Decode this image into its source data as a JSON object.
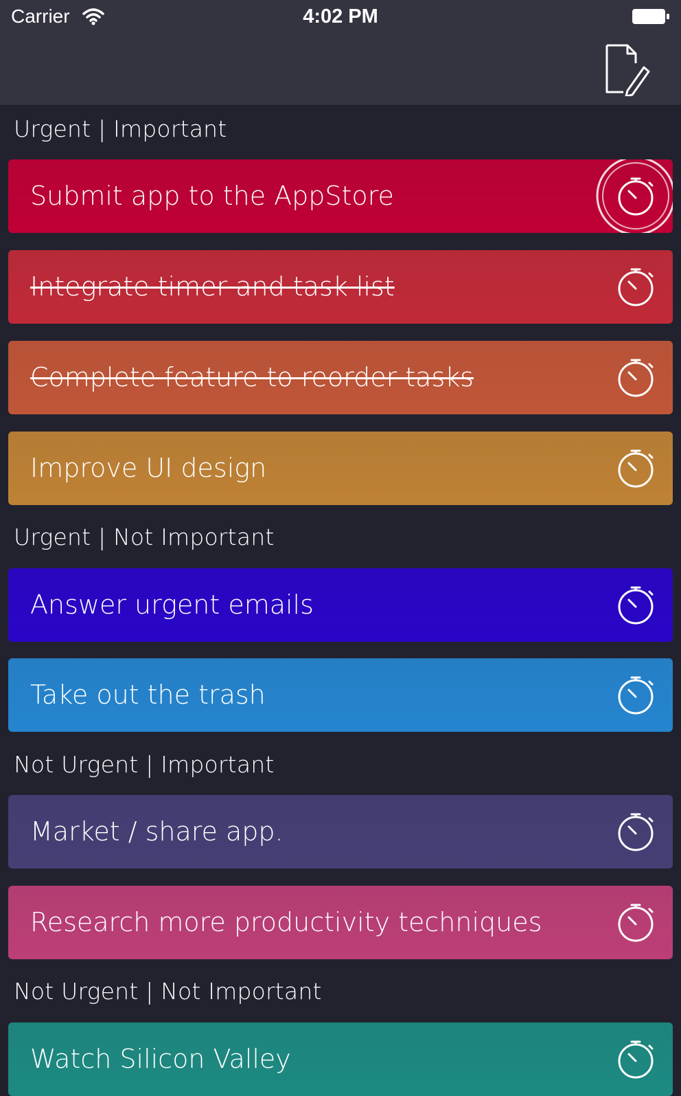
{
  "status_bar": {
    "carrier": "Carrier",
    "time": "4:02 PM"
  },
  "nav": {
    "compose_icon": "compose-icon"
  },
  "sections": [
    {
      "title": "Urgent | Important",
      "tasks": [
        {
          "label": "Submit app to the AppStore",
          "done": false,
          "color": "#c00035",
          "active": true
        },
        {
          "label": "Integrate timer and task list",
          "done": true,
          "color": "#c12a38"
        },
        {
          "label": "Complete feature to reorder tasks",
          "done": true,
          "color": "#c15638"
        },
        {
          "label": "Improve UI design",
          "done": false,
          "color": "#bf8235"
        }
      ]
    },
    {
      "title": "Urgent | Not Important",
      "tasks": [
        {
          "label": "Answer urgent emails",
          "done": false,
          "color": "#2a05c8"
        },
        {
          "label": "Take out the trash",
          "done": false,
          "color": "#2585cf"
        }
      ]
    },
    {
      "title": "Not Urgent | Important",
      "tasks": [
        {
          "label": "Market / share app.",
          "done": false,
          "color": "#453f75"
        },
        {
          "label": "Research more productivity techniques",
          "done": false,
          "color": "#bc3f76"
        }
      ]
    },
    {
      "title": "Not Urgent | Not Important",
      "tasks": [
        {
          "label": "Watch Silicon Valley",
          "done": false,
          "color": "#1d8a82"
        }
      ]
    }
  ],
  "icons": {
    "timer": "stopwatch-icon"
  }
}
